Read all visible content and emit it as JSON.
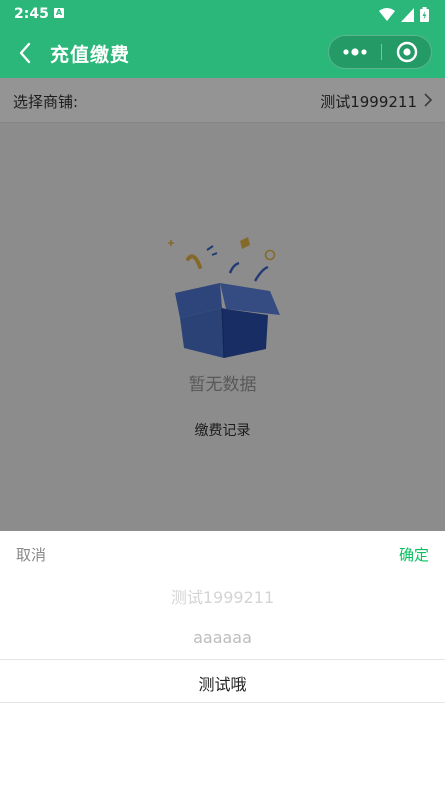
{
  "status_bar": {
    "time": "2:45",
    "notification_letter": "A"
  },
  "nav": {
    "title": "充值缴费"
  },
  "shop_selector": {
    "label": "选择商铺:",
    "value": "测试1999211"
  },
  "empty_state": {
    "text": "暂无数据"
  },
  "links": {
    "payment_records": "缴费记录"
  },
  "picker": {
    "cancel_label": "取消",
    "confirm_label": "确定",
    "options": [
      "测试1999211",
      "aaaaaa",
      "测试哦"
    ],
    "selected_index": 2
  },
  "colors": {
    "brand_green": "#2bb77a",
    "confirm_green": "#07c160"
  }
}
